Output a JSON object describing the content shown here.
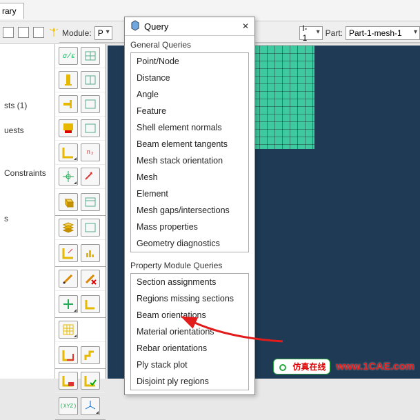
{
  "tab": {
    "name": "rary"
  },
  "row2": {
    "lamp": "lamp-icon"
  },
  "module_bar": {
    "module_label": "Module:",
    "module_value": "P",
    "part_label": "Part:",
    "part_value": "Part-1-mesh-1",
    "combo_hidden": "l-1"
  },
  "tree": {
    "items": [
      "sts (1)",
      "uests",
      "Constraints",
      "s"
    ]
  },
  "popup": {
    "title": "Query",
    "close": "✕",
    "groups": [
      {
        "label": "General Queries",
        "items": [
          "Point/Node",
          "Distance",
          "Angle",
          "Feature",
          "Shell element normals",
          "Beam element tangents",
          "Mesh stack orientation",
          "Mesh",
          "Element",
          "Mesh gaps/intersections",
          "Mass properties",
          "Geometry diagnostics"
        ]
      },
      {
        "label": "Property Module Queries",
        "items": [
          "Section assignments",
          "Regions missing sections",
          "Beam orientations",
          "Material orientations",
          "Rebar orientations",
          "Ply stack plot",
          "Disjoint ply regions"
        ]
      }
    ]
  },
  "watermark": {
    "bubble": "仿真在线",
    "url": "www.1CAE.com"
  }
}
